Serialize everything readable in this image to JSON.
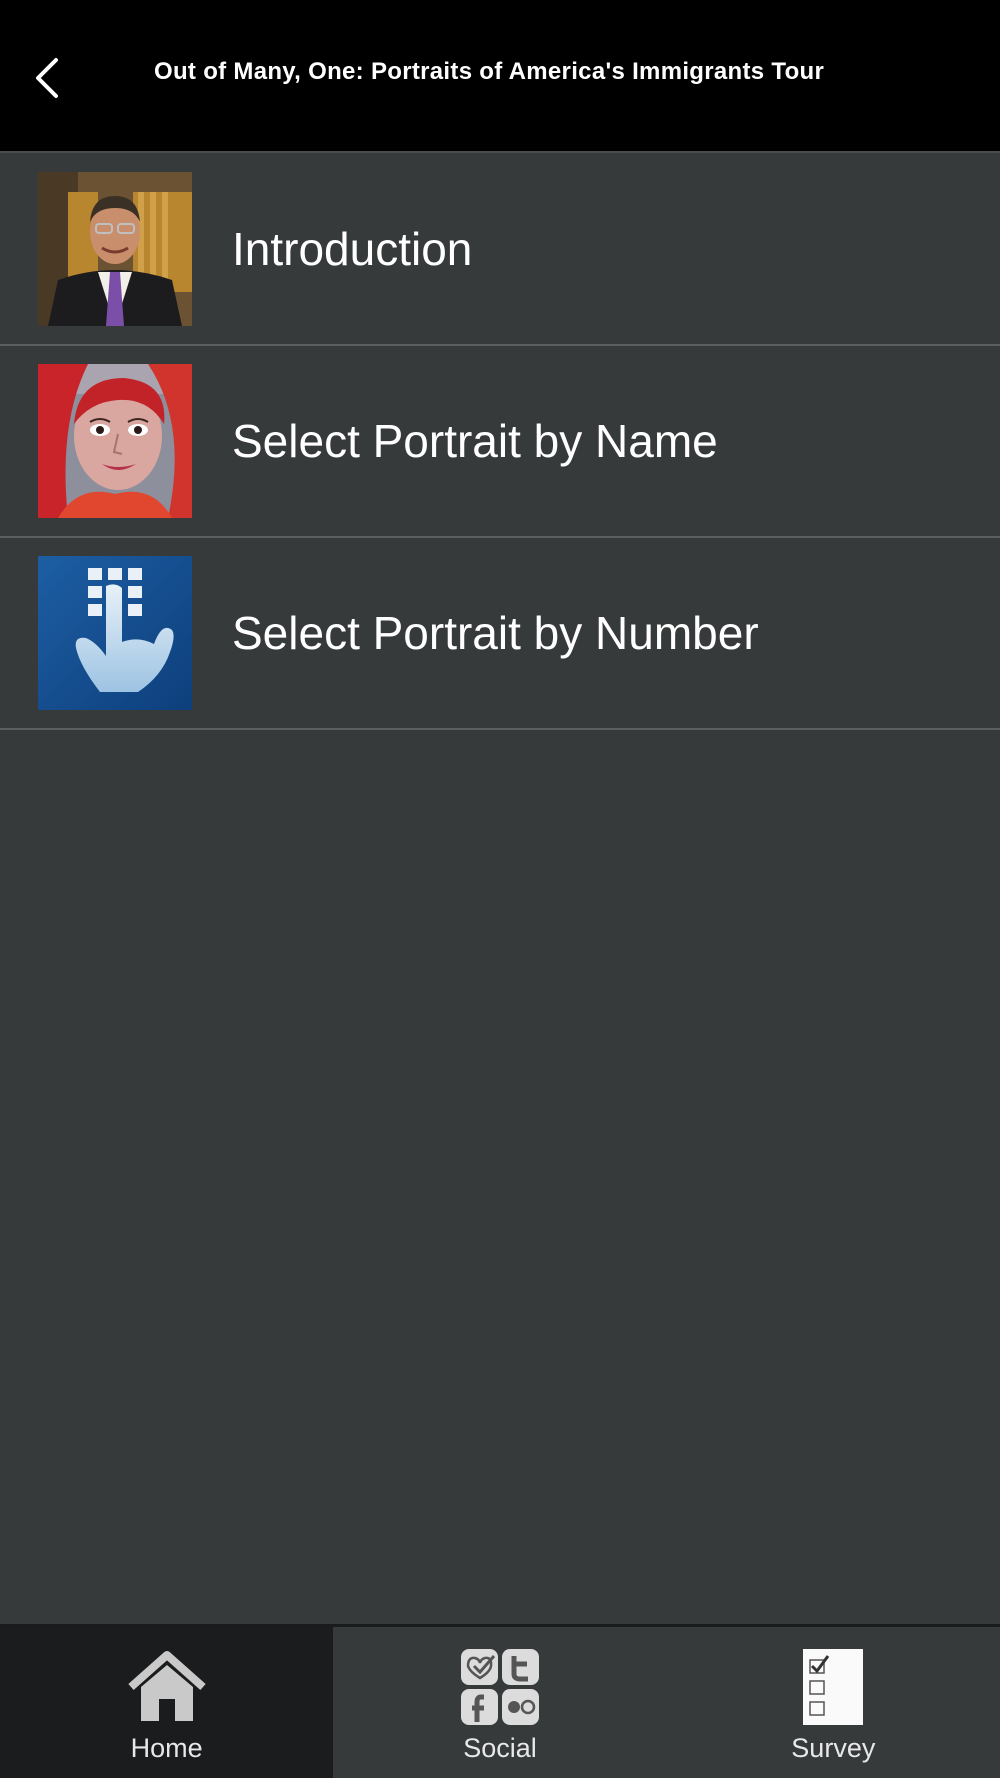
{
  "header": {
    "title": "Out of Many, One: Portraits of America's Immigrants Tour",
    "back_icon": "chevron-left-icon"
  },
  "menu": [
    {
      "label": "Introduction",
      "thumb": "portrait-photo-man"
    },
    {
      "label": "Select Portrait by Name",
      "thumb": "painted-portrait-woman"
    },
    {
      "label": "Select Portrait by Number",
      "thumb": "keypad-finger-icon"
    }
  ],
  "tabs": [
    {
      "label": "Home",
      "icon": "home-icon",
      "active": true
    },
    {
      "label": "Social",
      "icon": "social-icons",
      "active": false
    },
    {
      "label": "Survey",
      "icon": "survey-checklist-icon",
      "active": false
    }
  ],
  "colors": {
    "background": "#373a3b",
    "header": "#000000",
    "active_tab": "#1b1c1d"
  }
}
